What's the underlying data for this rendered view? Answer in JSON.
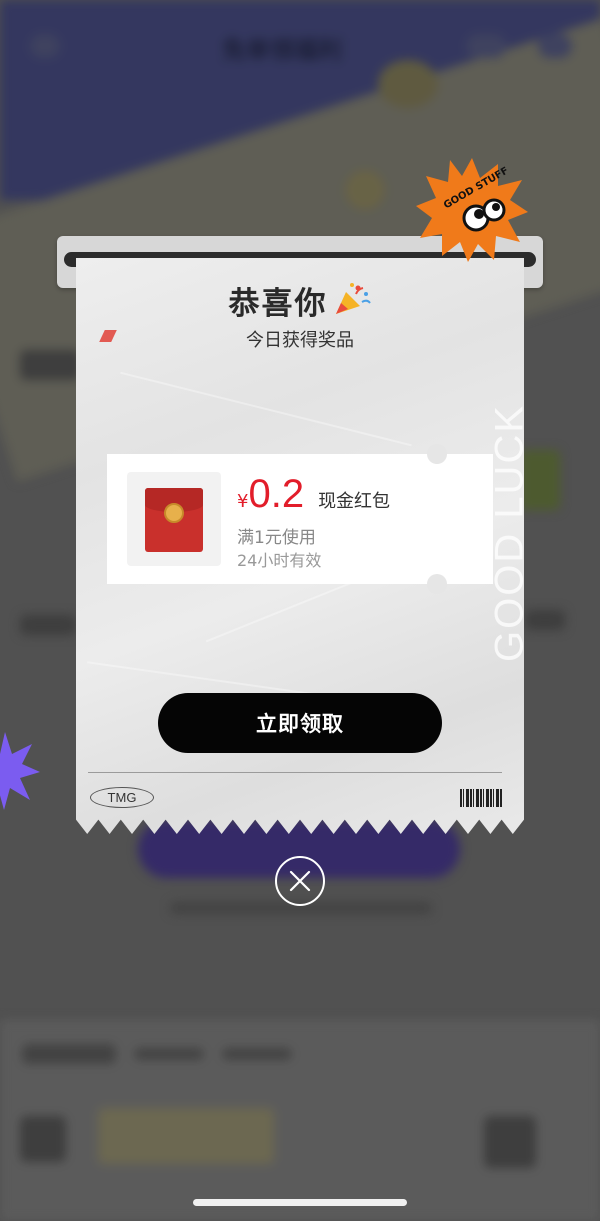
{
  "background_app": {
    "title": "免单领福利"
  },
  "popup": {
    "title": "恭喜你",
    "subtitle": "今日获得奖品",
    "side_text": "GOOD LUCK",
    "sticker_text": "GOOD STUFF",
    "coupon": {
      "currency": "¥",
      "amount": "0.2",
      "type_label": "现金红包",
      "condition": "满1元使用",
      "validity": "24小时有效"
    },
    "claim_button": "立即领取",
    "footer_tag": "TMG"
  },
  "colors": {
    "accent_red": "#e21d2a",
    "button_black": "#050505",
    "burst_orange": "#f07a1a",
    "star_purple": "#7b5cf0"
  }
}
